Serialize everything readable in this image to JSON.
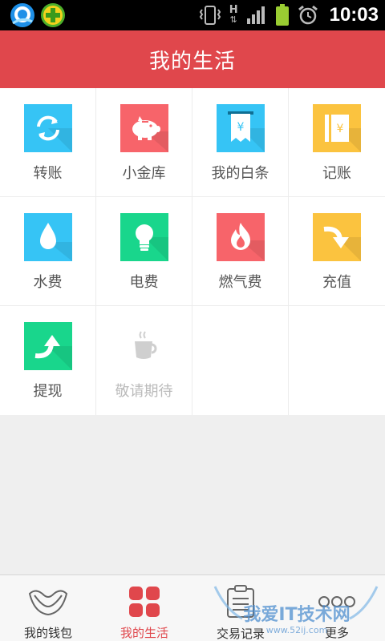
{
  "statusbar": {
    "time": "10:03",
    "network_type": "H",
    "icons": [
      "qq-browser-icon",
      "360-security-icon",
      "vibrate-icon",
      "signal-icon",
      "battery-icon",
      "alarm-icon"
    ]
  },
  "header": {
    "title": "我的生活"
  },
  "grid": [
    {
      "label": "转账",
      "icon": "transfer-icon",
      "color": "#36c4f5"
    },
    {
      "label": "小金库",
      "icon": "piggy-bank-icon",
      "color": "#f7646a"
    },
    {
      "label": "我的白条",
      "icon": "receipt-icon",
      "color": "#36c4f5",
      "glyph": "¥"
    },
    {
      "label": "记账",
      "icon": "ledger-icon",
      "color": "#fbc33f",
      "glyph": "¥"
    },
    {
      "label": "水费",
      "icon": "water-drop-icon",
      "color": "#36c4f5"
    },
    {
      "label": "电费",
      "icon": "light-bulb-icon",
      "color": "#19d68c"
    },
    {
      "label": "燃气费",
      "icon": "flame-icon",
      "color": "#f7646a"
    },
    {
      "label": "充值",
      "icon": "recharge-arrow-icon",
      "color": "#fbc33f"
    },
    {
      "label": "提现",
      "icon": "withdraw-arrow-icon",
      "color": "#19d68c"
    },
    {
      "label": "敬请期待",
      "icon": "coffee-cup-icon",
      "color": "#cfcfcf"
    }
  ],
  "bottom_nav": {
    "items": [
      {
        "label": "我的钱包",
        "icon": "wallet-icon",
        "active": false
      },
      {
        "label": "我的生活",
        "icon": "grid-squares-icon",
        "active": true
      },
      {
        "label": "交易记录",
        "icon": "clipboard-icon",
        "active": false
      },
      {
        "label": "更多",
        "icon": "more-dots-icon",
        "active": false
      }
    ]
  },
  "watermark": {
    "text": "我爱IT技术网",
    "url_text": "www.52ij.com"
  },
  "colors": {
    "accent": "#e0474c",
    "blue": "#36c4f5",
    "red": "#f7646a",
    "green": "#19d68c",
    "yellow": "#fbc33f"
  }
}
